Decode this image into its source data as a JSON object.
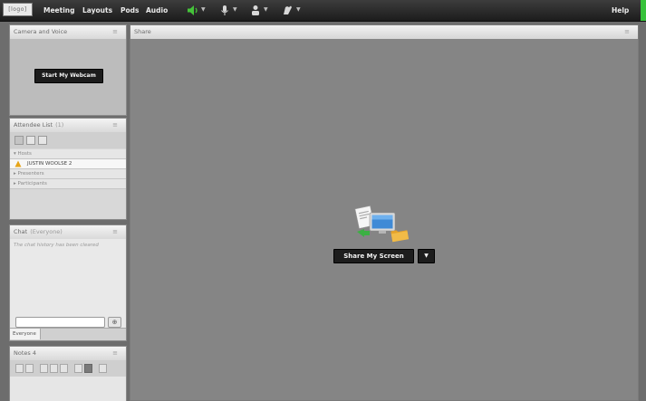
{
  "topbar": {
    "logo": "[logo]",
    "menu": [
      "Meeting",
      "Layouts",
      "Pods",
      "Audio"
    ],
    "help": "Help"
  },
  "camera_pod": {
    "title": "Camera and Voice",
    "start_webcam": "Start My Webcam"
  },
  "attendee_pod": {
    "title": "Attendee List",
    "count": "(1)",
    "sections": [
      "Hosts",
      "Presenters",
      "Participants"
    ],
    "host_name": "JUSTIN WOOLSE 2"
  },
  "chat_pod": {
    "title": "Chat",
    "scope": "(Everyone)",
    "status": "The chat history has been cleared",
    "input_value": "",
    "tab_label": "Everyone"
  },
  "notes_pod": {
    "title": "Notes 4"
  },
  "share_pod": {
    "title": "Share",
    "share_button": "Share My Screen"
  },
  "icons": {
    "pod_menu": "menu-icon",
    "dropdown": "chevron-down-icon",
    "speaker": "speaker-icon",
    "microphone": "microphone-icon",
    "person": "person-icon",
    "raise_hand": "raise-hand-icon",
    "user_role": "host-icon",
    "send": "send-icon"
  },
  "colors": {
    "topbar": "#262626",
    "speaker_active": "#45c43a",
    "status_corner": "#36c23a",
    "canvas": "#858585"
  }
}
